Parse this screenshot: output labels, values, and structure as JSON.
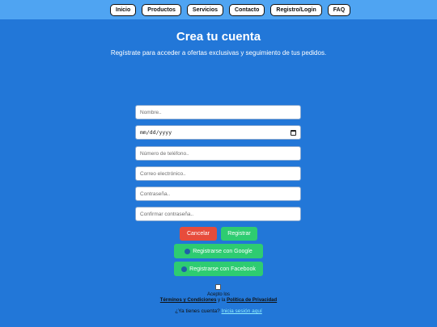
{
  "nav": {
    "items": [
      {
        "label": "Inicio"
      },
      {
        "label": "Productos"
      },
      {
        "label": "Servicios"
      },
      {
        "label": "Contacto"
      },
      {
        "label": "Registro/Login"
      },
      {
        "label": "FAQ"
      }
    ]
  },
  "header": {
    "title": "Crea tu cuenta",
    "subtitle": "Regístrate para acceder a ofertas exclusivas y seguimiento de tus pedidos."
  },
  "form": {
    "name_placeholder": "Nombre..",
    "date_placeholder": "mm/dd/yyyy",
    "phone_placeholder": "Número de teléfono..",
    "email_placeholder": "Correo electrónico..",
    "password_placeholder": "Contraseña..",
    "confirm_placeholder": "Confirmar contraseña.."
  },
  "buttons": {
    "cancel": "Cancelar",
    "register": "Registrar",
    "google": "Registrarse con Google",
    "facebook": "Registrarse con Facebook"
  },
  "terms": {
    "line1": "Acepto los",
    "terms_link": "Términos y Condiciones",
    "and": " y la ",
    "privacy_link": "Política de Privacidad"
  },
  "login": {
    "question": "¿Ya tienes cuenta? ",
    "link": "Inicia sesión aquí"
  },
  "colors": {
    "background": "#2277d8",
    "topbar": "#4fa4f2",
    "cancel": "#e74c3c",
    "register": "#2ecc71"
  }
}
